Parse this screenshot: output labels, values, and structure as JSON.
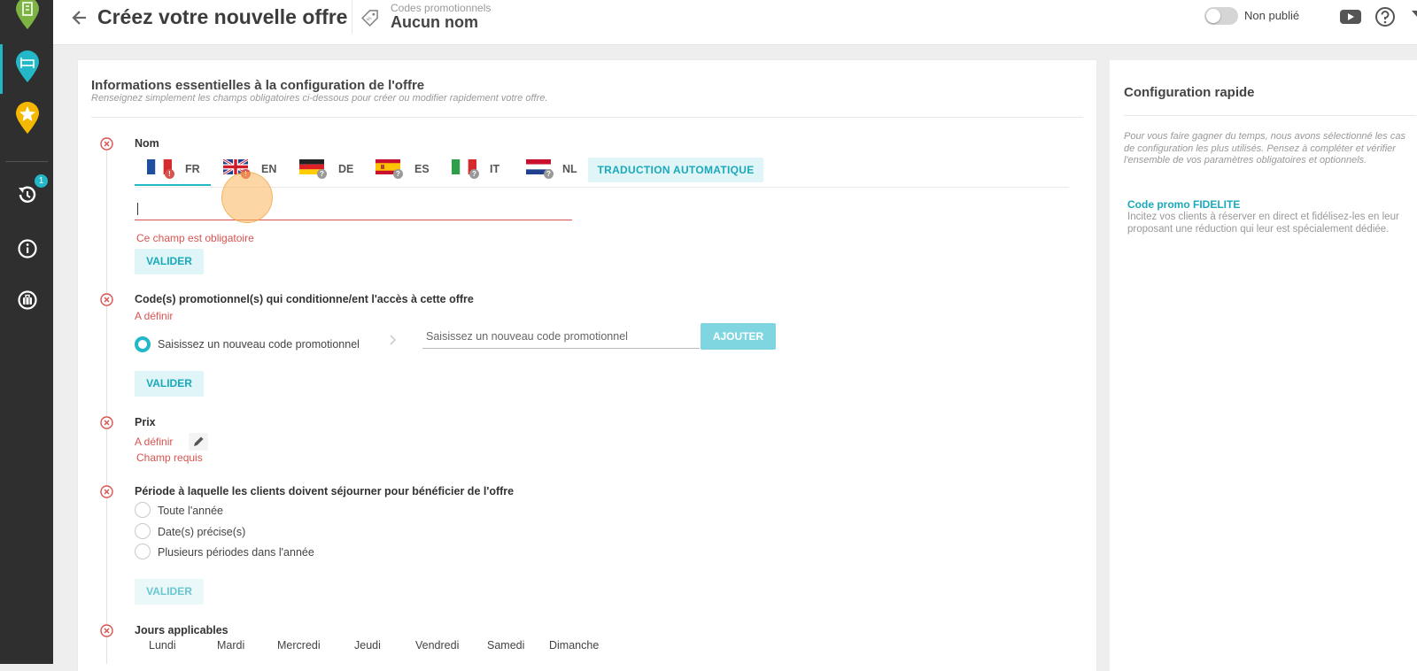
{
  "header": {
    "title": "Créez votre nouvelle offre",
    "subtitle": "Codes promotionnels",
    "offer_name": "Aucun nom",
    "status_label": "Non publié"
  },
  "sidebar": {
    "history_badge": "1"
  },
  "main": {
    "title": "Informations essentielles à la configuration de l'offre",
    "subtitle": "Renseignez simplement les champs obligatoires ci-dessous pour créer ou modifier rapidement votre offre.",
    "nom": {
      "label": "Nom",
      "languages": [
        {
          "code": "FR",
          "active": true,
          "badge": "!"
        },
        {
          "code": "EN",
          "badge": "!"
        },
        {
          "code": "DE",
          "badge": "?"
        },
        {
          "code": "ES",
          "badge": "?"
        },
        {
          "code": "IT",
          "badge": "?"
        },
        {
          "code": "NL",
          "badge": "?"
        }
      ],
      "translate_button": "TRADUCTION AUTOMATIQUE",
      "input_value": "",
      "error": "Ce champ est obligatoire",
      "validate": "VALIDER"
    },
    "codes": {
      "label": "Code(s) promotionnel(s) qui conditionne/ent l'accès à cette offre",
      "status": "A définir",
      "radio_label": "Saisissez un nouveau code promotionnel",
      "input_placeholder": "Saisissez un nouveau code promotionnel",
      "add_button": "AJOUTER",
      "validate": "VALIDER"
    },
    "prix": {
      "label": "Prix",
      "status": "A définir",
      "required": "Champ requis"
    },
    "periode": {
      "label": "Période à laquelle les clients doivent séjourner pour bénéficier de l'offre",
      "options": [
        "Toute l'année",
        "Date(s) précise(s)",
        "Plusieurs périodes dans l'année"
      ],
      "validate": "VALIDER"
    },
    "jours": {
      "label": "Jours applicables",
      "days": [
        "Lundi",
        "Mardi",
        "Mercredi",
        "Jeudi",
        "Vendredi",
        "Samedi",
        "Dimanche"
      ]
    }
  },
  "quick_config": {
    "title": "Configuration rapide",
    "description": "Pour vous faire gagner du temps, nous avons sélectionné les cas de configuration les plus utilisés. Pensez à compléter et vérifier l'ensemble de vos paramètres obligatoires et optionnels.",
    "item_title": "Code promo FIDELITE",
    "item_desc": "Incitez vos clients à réserver en direct et fidélisez-les en leur proposant une réduction qui leur est spécialement dédiée."
  },
  "colors": {
    "accent": "#22b8c8",
    "error": "#d9534f",
    "pin_green": "#7cb342",
    "pin_teal": "#22b8c8",
    "pin_yellow": "#f5b800"
  }
}
